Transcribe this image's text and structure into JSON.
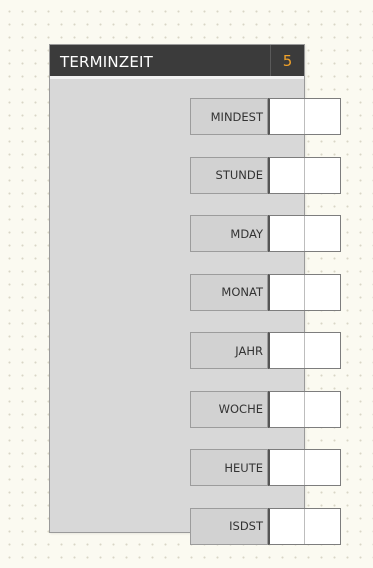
{
  "node": {
    "title": "TERMINZEIT",
    "count": "5",
    "outputs": [
      {
        "label": "MINDEST",
        "value": ""
      },
      {
        "label": "STUNDE",
        "value": ""
      },
      {
        "label": "MDAY",
        "value": ""
      },
      {
        "label": "MONAT",
        "value": ""
      },
      {
        "label": "JAHR",
        "value": ""
      },
      {
        "label": "WOCHE",
        "value": ""
      },
      {
        "label": "HEUTE",
        "value": ""
      },
      {
        "label": "ISDST",
        "value": ""
      }
    ]
  },
  "colors": {
    "canvas": "#fbfaf1",
    "header": "#3b3b3b",
    "count": "#f0a22a",
    "body": "#d8d8d8"
  }
}
